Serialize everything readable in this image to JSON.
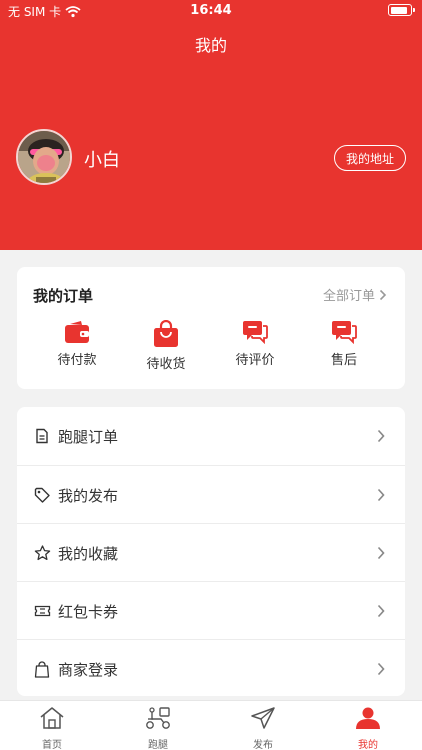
{
  "status_bar": {
    "carrier": "无 SIM 卡",
    "time": "16:44",
    "battery_level": 0.9
  },
  "nav": {
    "title": "我的"
  },
  "profile": {
    "username": "小白",
    "address_button": "我的地址"
  },
  "orders": {
    "title": "我的订单",
    "view_all": "全部订单",
    "items": [
      {
        "label": "待付款",
        "icon": "wallet-icon"
      },
      {
        "label": "待收货",
        "icon": "shopping-bag-icon"
      },
      {
        "label": "待评价",
        "icon": "chat-icon"
      },
      {
        "label": "售后",
        "icon": "chat-icon"
      }
    ],
    "accent_color": "#e8342f"
  },
  "menu": {
    "items": [
      {
        "label": "跑腿订单",
        "icon": "document-icon"
      },
      {
        "label": "我的发布",
        "icon": "tag-icon"
      },
      {
        "label": "我的收藏",
        "icon": "star-icon"
      },
      {
        "label": "红包卡券",
        "icon": "ticket-icon"
      },
      {
        "label": "商家登录",
        "icon": "bag-icon"
      }
    ]
  },
  "tabbar": {
    "items": [
      {
        "label": "首页",
        "icon": "home-icon"
      },
      {
        "label": "跑腿",
        "icon": "delivery-scooter-icon"
      },
      {
        "label": "发布",
        "icon": "send-icon"
      },
      {
        "label": "我的",
        "icon": "person-icon",
        "active": true
      }
    ]
  },
  "colors": {
    "brand": "#e8342f",
    "background": "#f2f2f2"
  }
}
